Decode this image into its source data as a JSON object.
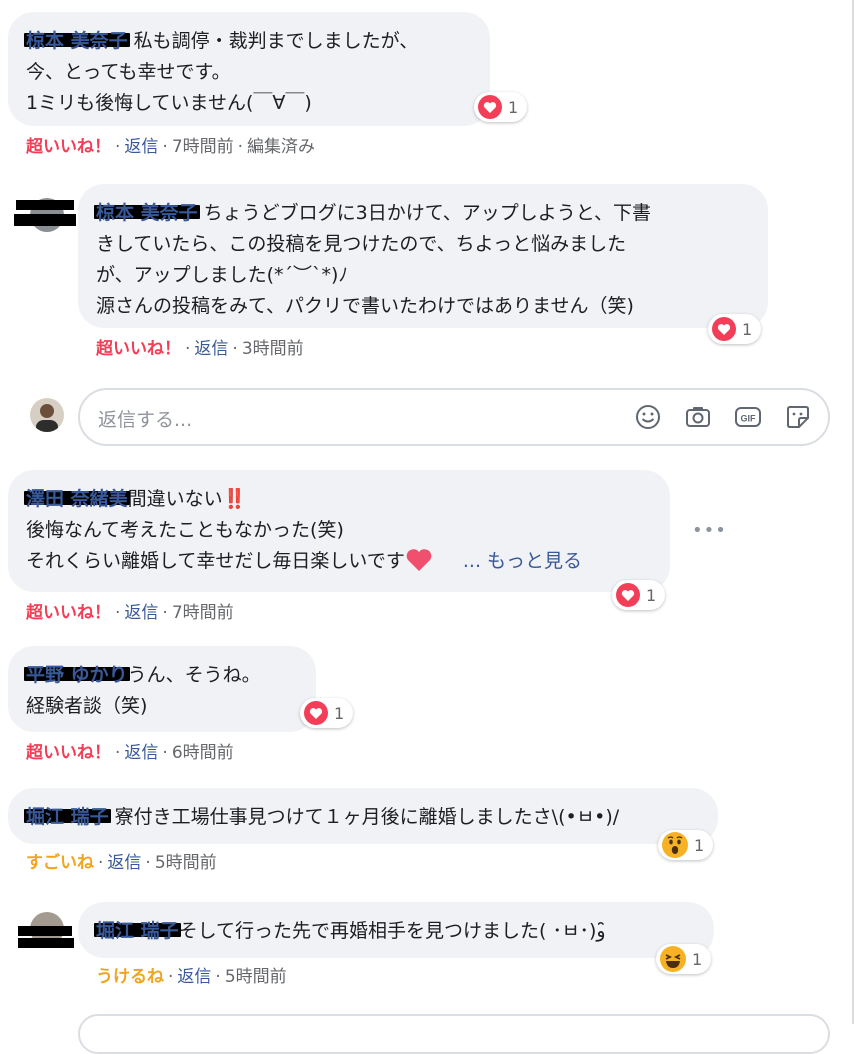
{
  "comments": [
    {
      "author": "椋本 美奈子",
      "lines": [
        "私も調停・裁判までしましたが、",
        "今、とっても幸せです。",
        "1ミリも後悔していません(￣∀￣)"
      ],
      "reaction_count": "1",
      "reaction_label": "超いいね！",
      "reply_label": "返信",
      "time": "7時間前",
      "edited": "編集済み"
    },
    {
      "author": "椋本 美奈子",
      "lines": [
        "ちょうどブログに3日かけて、アップしようと、下書",
        "きしていたら、この投稿を見つけたので、ちよっと悩みました",
        "が、アップしました(*´︶`*)ﾉ",
        "源さんの投稿をみて、パクリで書いたわけではありません（笑)"
      ],
      "reaction_count": "1",
      "reaction_label": "超いいね！",
      "reply_label": "返信",
      "time": "3時間前"
    },
    {
      "author": "澤田 奈緒美",
      "lines": [
        "間違いない",
        "後悔なんて考えたこともなかった(笑)",
        "それくらい離婚して幸せだし毎日楽しいです"
      ],
      "emoji_exclaim": "‼️",
      "see_more": "... もっと見る",
      "reaction_count": "1",
      "reaction_label": "超いいね！",
      "reply_label": "返信",
      "time": "7時間前"
    },
    {
      "author": "平野 ゆかり",
      "lines": [
        "うん、そうね。",
        "経験者談（笑)"
      ],
      "reaction_count": "1",
      "reaction_label": "超いいね！",
      "reply_label": "返信",
      "time": "6時間前"
    },
    {
      "author": "堀江 瑞子",
      "lines": [
        "寮付き工場仕事見つけて１ヶ月後に離婚しましたさ\\(•ㅂ•)/"
      ],
      "reaction_count": "1",
      "reaction_label": "すごいね",
      "reply_label": "返信",
      "time": "5時間前"
    },
    {
      "author": "堀江 瑞子",
      "lines": [
        "そして行った先で再婚相手を見つけました( ･ㅂ･)و ̑̑"
      ],
      "reaction_count": "1",
      "reaction_label": "うけるね",
      "reply_label": "返信",
      "time": "5時間前"
    }
  ],
  "reply_box": {
    "placeholder": "返信する..."
  },
  "more_options": "•••",
  "colors": {
    "love": "#f33e58",
    "wow_haha": "#f7b125",
    "link": "#385898",
    "meta": "#65676b",
    "bubble": "#f0f2f5"
  }
}
